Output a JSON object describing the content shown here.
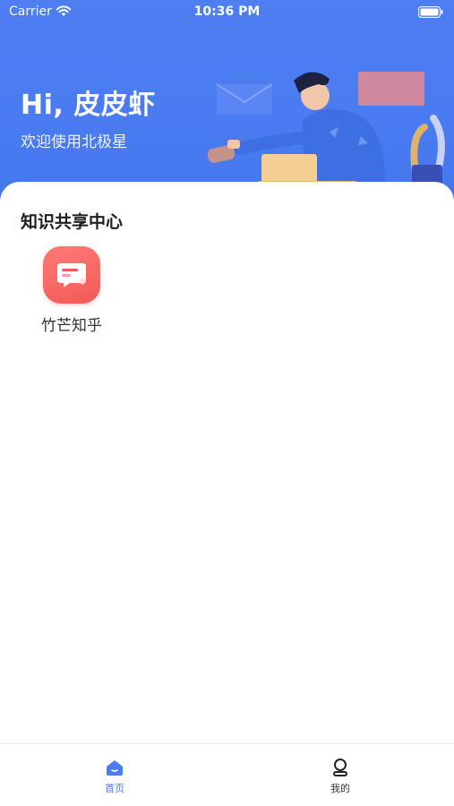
{
  "status_bar": {
    "carrier": "Carrier",
    "time": "10:36 PM",
    "icons": [
      "wifi-icon",
      "battery-icon"
    ]
  },
  "header": {
    "greeting": "Hi, 皮皮虾",
    "subtitle": "欢迎使用北极星"
  },
  "section": {
    "title": "知识共享中心",
    "items": [
      {
        "label": "竹芒知乎",
        "icon": "chat-message-icon",
        "color": "#f45d5a"
      }
    ]
  },
  "tabbar": {
    "tabs": [
      {
        "label": "首页",
        "icon": "home-icon",
        "active": true
      },
      {
        "label": "我的",
        "icon": "user-icon",
        "active": false
      }
    ],
    "active_color": "#4a7bf0",
    "inactive_color": "#333333"
  },
  "colors": {
    "banner": "#4a7bf0",
    "accent": "#f45d5a"
  }
}
